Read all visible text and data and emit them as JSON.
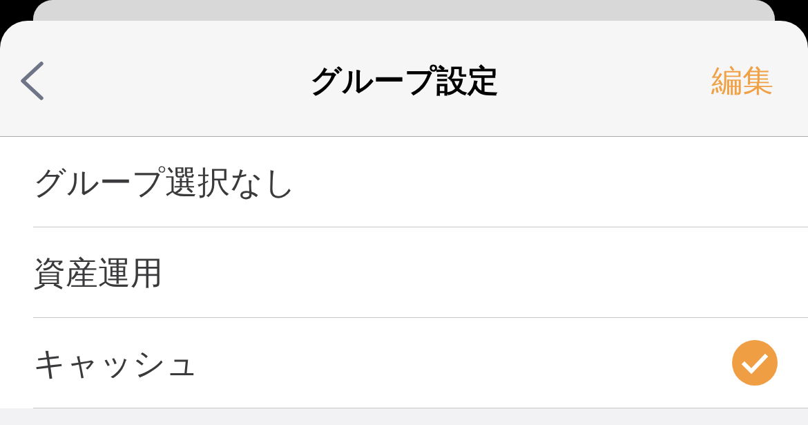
{
  "nav": {
    "title": "グループ設定",
    "action": "編集"
  },
  "groups": [
    {
      "label": "グループ選択なし",
      "selected": false
    },
    {
      "label": "資産運用",
      "selected": false
    },
    {
      "label": "キャッシュ",
      "selected": true
    }
  ]
}
